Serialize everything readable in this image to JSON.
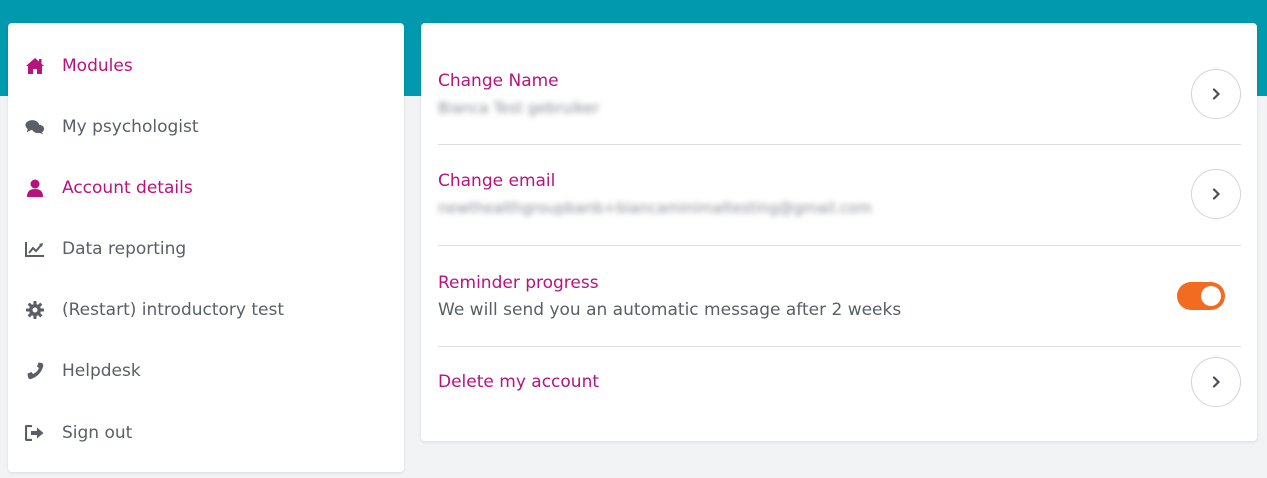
{
  "colors": {
    "header_band": "#0099ad",
    "accent": "#b8127f",
    "text_muted": "#5a5f66",
    "toggle_on": "#f26b21",
    "background": "#f2f3f5"
  },
  "sidebar": {
    "items": [
      {
        "label": "Modules",
        "icon": "home-icon",
        "active": true
      },
      {
        "label": "My psychologist",
        "icon": "chat-bubbles-icon",
        "active": false
      },
      {
        "label": "Account details",
        "icon": "user-icon",
        "active": true
      },
      {
        "label": "Data reporting",
        "icon": "line-chart-icon",
        "active": false
      },
      {
        "label": "(Restart) introductory test",
        "icon": "gear-icon",
        "active": false
      },
      {
        "label": "Helpdesk",
        "icon": "phone-icon",
        "active": false
      },
      {
        "label": "Sign out",
        "icon": "sign-out-icon",
        "active": false
      }
    ]
  },
  "account": {
    "change_name": {
      "title": "Change Name",
      "value": "Bianca Test gebruiker"
    },
    "change_email": {
      "title": "Change email",
      "value": "newthealthgroupbanb+biancaminimaltesting@gmail.com"
    },
    "reminder": {
      "title": "Reminder progress",
      "description": "We will send you an automatic message after 2 weeks",
      "enabled": true
    },
    "delete": {
      "title": "Delete my account"
    }
  }
}
